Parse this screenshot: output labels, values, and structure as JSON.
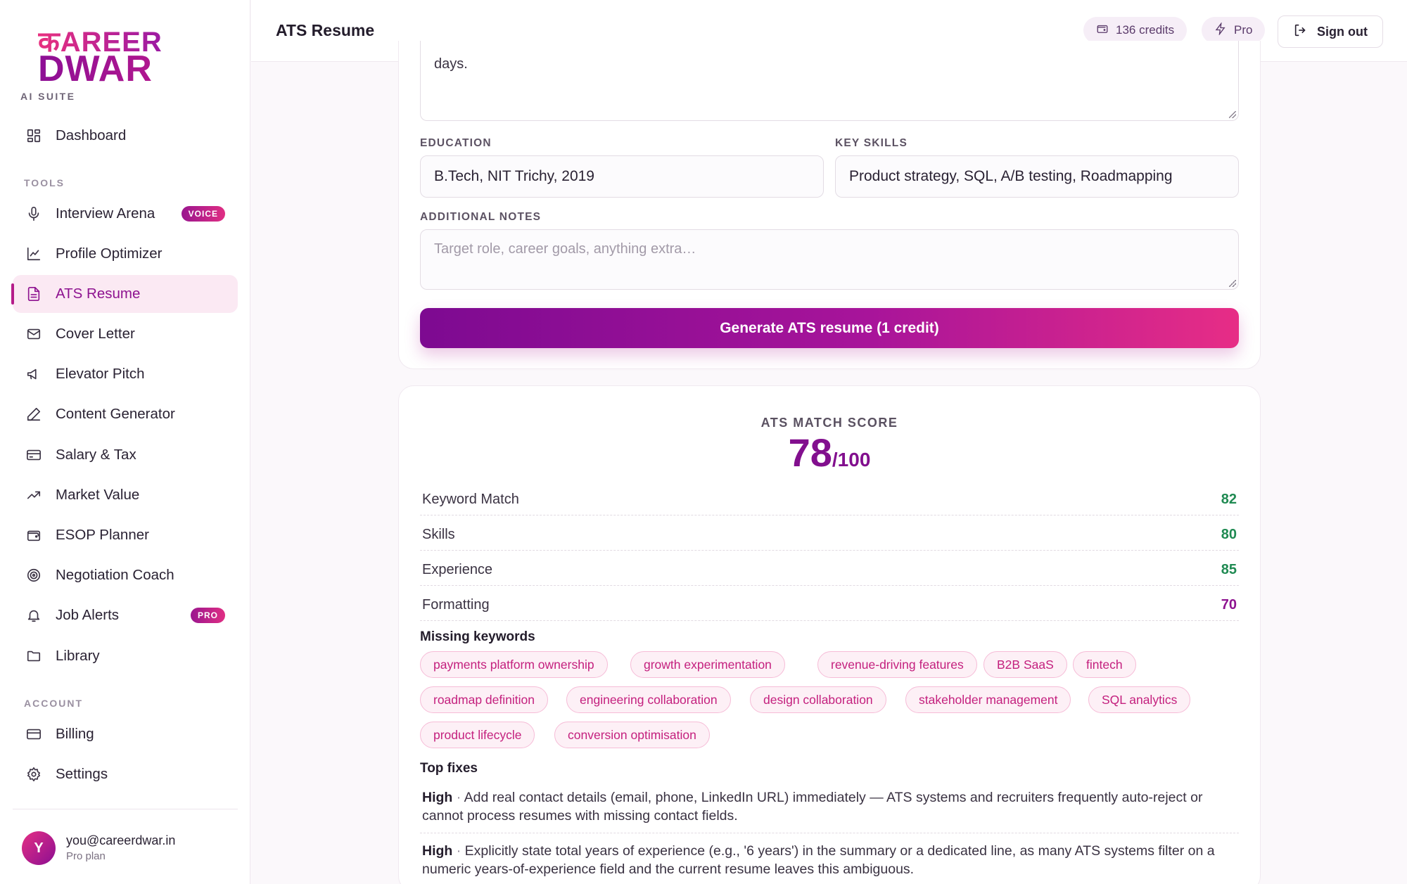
{
  "brand": {
    "logo_line1": "कAREER",
    "logo_line2": "DWAR",
    "suite": "AI SUITE"
  },
  "sidebar": {
    "dashboard": {
      "label": "Dashboard",
      "icon": "grid-icon"
    },
    "tools_heading": "TOOLS",
    "tools": [
      {
        "label": "Interview Arena",
        "icon": "microphone-icon",
        "badge": "VOICE"
      },
      {
        "label": "Profile Optimizer",
        "icon": "chart-icon"
      },
      {
        "label": "ATS Resume",
        "icon": "document-icon",
        "active": true
      },
      {
        "label": "Cover Letter",
        "icon": "mail-icon"
      },
      {
        "label": "Elevator Pitch",
        "icon": "megaphone-icon"
      },
      {
        "label": "Content Generator",
        "icon": "pen-icon"
      },
      {
        "label": "Salary & Tax",
        "icon": "card-icon"
      },
      {
        "label": "Market Value",
        "icon": "trend-icon"
      },
      {
        "label": "ESOP Planner",
        "icon": "wallet-icon"
      },
      {
        "label": "Negotiation Coach",
        "icon": "target-icon"
      },
      {
        "label": "Job Alerts",
        "icon": "bell-icon",
        "badge": "PRO"
      },
      {
        "label": "Library",
        "icon": "folder-icon"
      }
    ],
    "account_heading": "ACCOUNT",
    "account": [
      {
        "label": "Billing",
        "icon": "billing-icon"
      },
      {
        "label": "Settings",
        "icon": "gear-icon"
      }
    ],
    "user": {
      "initial": "Y",
      "email": "you@careerdwar.in",
      "plan": "Pro plan"
    }
  },
  "header": {
    "title": "ATS Resume",
    "credits": "136 credits",
    "plan": "Pro",
    "signout": "Sign out"
  },
  "form": {
    "experience_tail": "days.",
    "education_label": "EDUCATION",
    "education_value": "B.Tech, NIT Trichy, 2019",
    "skills_label": "KEY SKILLS",
    "skills_value": "Product strategy, SQL, A/B testing, Roadmapping",
    "notes_label": "ADDITIONAL NOTES",
    "notes_placeholder": "Target role, career goals, anything extra…",
    "generate": "Generate ATS resume (1 credit)"
  },
  "score": {
    "title": "ATS MATCH SCORE",
    "value": "78",
    "max": "/100",
    "metrics": [
      {
        "label": "Keyword Match",
        "value": "82",
        "color": "#1f8a52"
      },
      {
        "label": "Skills",
        "value": "80",
        "color": "#1f8a52"
      },
      {
        "label": "Experience",
        "value": "85",
        "color": "#1f8a52"
      },
      {
        "label": "Formatting",
        "value": "70",
        "color": "#8e1390"
      }
    ],
    "missing_heading": "Missing keywords",
    "missing_keywords": [
      "payments platform ownership",
      "growth experimentation",
      "revenue-driving features",
      "B2B SaaS",
      "fintech",
      "roadmap definition",
      "engineering collaboration",
      "design collaboration",
      "stakeholder management",
      "SQL analytics",
      "product lifecycle",
      "conversion optimisation"
    ],
    "fixes_heading": "Top fixes",
    "fixes": [
      {
        "priority": "High",
        "sep": " · ",
        "text": "Add real contact details (email, phone, LinkedIn URL) immediately — ATS systems and recruiters frequently auto-reject or cannot process resumes with missing contact fields."
      },
      {
        "priority": "High",
        "sep": " · ",
        "text": "Explicitly state total years of experience (e.g., '6 years') in the summary or a dedicated line, as many ATS systems filter on a numeric years-of-experience field and the current resume leaves this ambiguous."
      }
    ]
  },
  "colors": {
    "brand_purple": "#8e1390",
    "brand_pink": "#e72d86",
    "good_green": "#1f8a52"
  }
}
